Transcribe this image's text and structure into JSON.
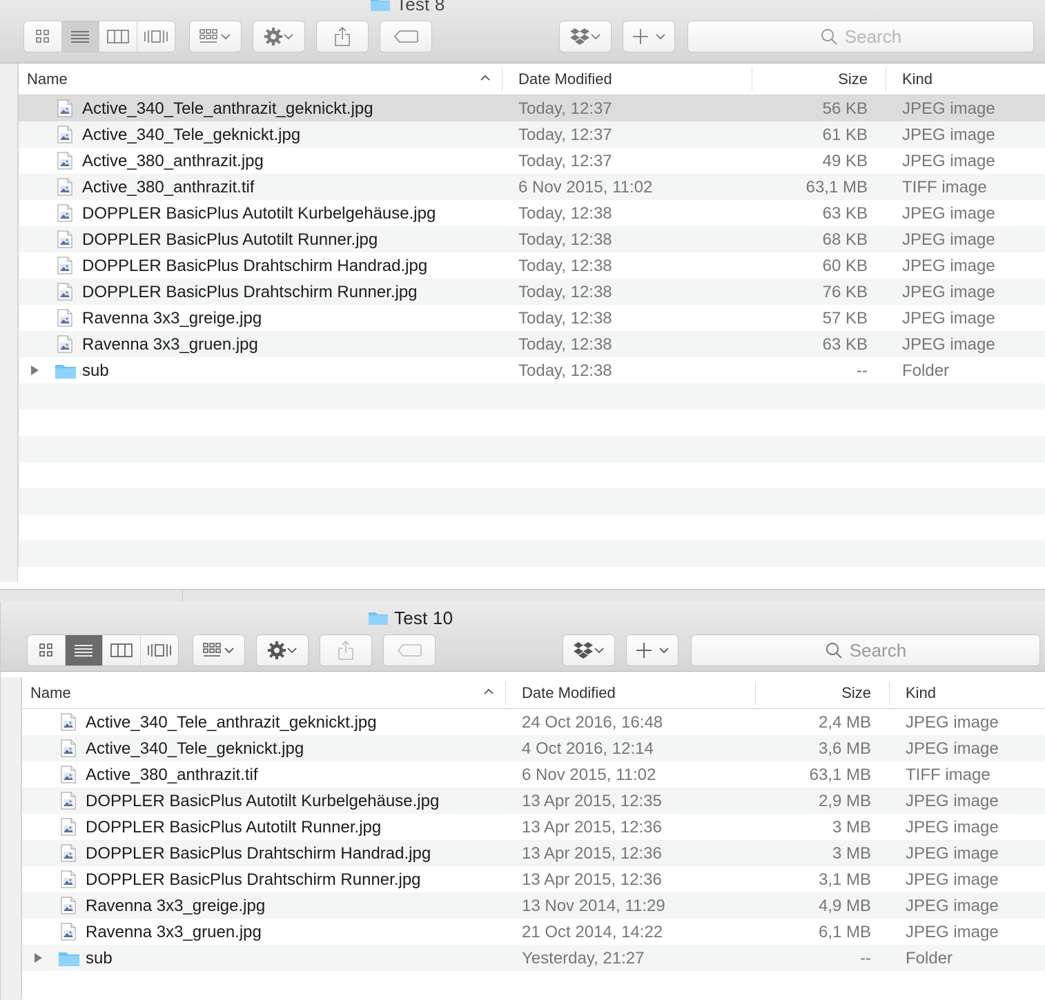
{
  "windows": [
    {
      "title": "Test 8",
      "search_placeholder": "Search",
      "headers": {
        "name": "Name",
        "date": "Date Modified",
        "size": "Size",
        "kind": "Kind"
      },
      "files": [
        {
          "name": "Active_340_Tele_anthrazit_geknickt.jpg",
          "date": "Today, 12:37",
          "size": "56 KB",
          "kind": "JPEG image",
          "type": "file"
        },
        {
          "name": "Active_340_Tele_geknickt.jpg",
          "date": "Today, 12:37",
          "size": "61 KB",
          "kind": "JPEG image",
          "type": "file"
        },
        {
          "name": "Active_380_anthrazit.jpg",
          "date": "Today, 12:37",
          "size": "49 KB",
          "kind": "JPEG image",
          "type": "file"
        },
        {
          "name": "Active_380_anthrazit.tif",
          "date": "6 Nov 2015, 11:02",
          "size": "63,1 MB",
          "kind": "TIFF image",
          "type": "file"
        },
        {
          "name": "DOPPLER BasicPlus Autotilt Kurbelgehäuse.jpg",
          "date": "Today, 12:38",
          "size": "63 KB",
          "kind": "JPEG image",
          "type": "file"
        },
        {
          "name": "DOPPLER BasicPlus Autotilt Runner.jpg",
          "date": "Today, 12:38",
          "size": "68 KB",
          "kind": "JPEG image",
          "type": "file"
        },
        {
          "name": "DOPPLER BasicPlus Drahtschirm Handrad.jpg",
          "date": "Today, 12:38",
          "size": "60 KB",
          "kind": "JPEG image",
          "type": "file"
        },
        {
          "name": "DOPPLER BasicPlus Drahtschirm Runner.jpg",
          "date": "Today, 12:38",
          "size": "76 KB",
          "kind": "JPEG image",
          "type": "file"
        },
        {
          "name": "Ravenna 3x3_greige.jpg",
          "date": "Today, 12:38",
          "size": "57 KB",
          "kind": "JPEG image",
          "type": "file"
        },
        {
          "name": "Ravenna 3x3_gruen.jpg",
          "date": "Today, 12:38",
          "size": "63 KB",
          "kind": "JPEG image",
          "type": "file"
        },
        {
          "name": "sub",
          "date": "Today, 12:38",
          "size": "--",
          "kind": "Folder",
          "type": "folder"
        }
      ]
    },
    {
      "title": "Test 10",
      "search_placeholder": "Search",
      "headers": {
        "name": "Name",
        "date": "Date Modified",
        "size": "Size",
        "kind": "Kind"
      },
      "files": [
        {
          "name": "Active_340_Tele_anthrazit_geknickt.jpg",
          "date": "24 Oct 2016, 16:48",
          "size": "2,4 MB",
          "kind": "JPEG image",
          "type": "file"
        },
        {
          "name": "Active_340_Tele_geknickt.jpg",
          "date": "4 Oct 2016, 12:14",
          "size": "3,6 MB",
          "kind": "JPEG image",
          "type": "file"
        },
        {
          "name": "Active_380_anthrazit.tif",
          "date": "6 Nov 2015, 11:02",
          "size": "63,1 MB",
          "kind": "TIFF image",
          "type": "file"
        },
        {
          "name": "DOPPLER BasicPlus Autotilt Kurbelgehäuse.jpg",
          "date": "13 Apr 2015, 12:35",
          "size": "2,9 MB",
          "kind": "JPEG image",
          "type": "file"
        },
        {
          "name": "DOPPLER BasicPlus Autotilt Runner.jpg",
          "date": "13 Apr 2015, 12:36",
          "size": "3 MB",
          "kind": "JPEG image",
          "type": "file"
        },
        {
          "name": "DOPPLER BasicPlus Drahtschirm Handrad.jpg",
          "date": "13 Apr 2015, 12:36",
          "size": "3 MB",
          "kind": "JPEG image",
          "type": "file"
        },
        {
          "name": "DOPPLER BasicPlus Drahtschirm Runner.jpg",
          "date": "13 Apr 2015, 12:36",
          "size": "3,1 MB",
          "kind": "JPEG image",
          "type": "file"
        },
        {
          "name": "Ravenna 3x3_greige.jpg",
          "date": "13 Nov 2014, 11:29",
          "size": "4,9 MB",
          "kind": "JPEG image",
          "type": "file"
        },
        {
          "name": "Ravenna 3x3_gruen.jpg",
          "date": "21 Oct 2014, 14:22",
          "size": "6,1 MB",
          "kind": "JPEG image",
          "type": "file"
        },
        {
          "name": "sub",
          "date": "Yesterday, 21:27",
          "size": "--",
          "kind": "Folder",
          "type": "folder"
        }
      ]
    }
  ],
  "colors": {
    "folder": "#6cc3f5",
    "selected_row": "#dcdcdc",
    "stripe": "#f4f5f5"
  },
  "icons": [
    "grid-view-icon",
    "list-view-icon",
    "column-view-icon",
    "cover-flow-icon",
    "group-icon",
    "gear-icon",
    "share-icon",
    "tag-icon",
    "dropbox-icon",
    "plus-icon",
    "search-icon",
    "folder-icon",
    "image-file-icon",
    "disclosure-triangle-icon",
    "sort-ascending-icon"
  ]
}
